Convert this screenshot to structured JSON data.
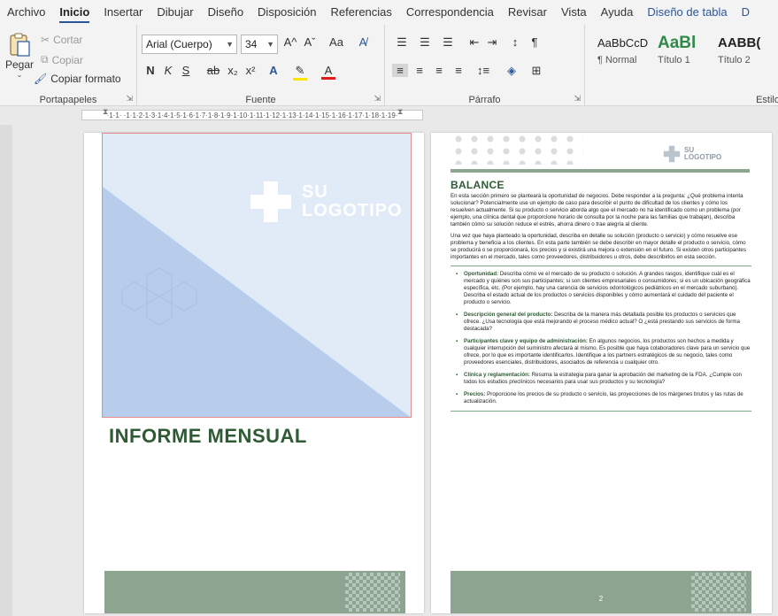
{
  "menu": {
    "items": [
      "Archivo",
      "Inicio",
      "Insertar",
      "Dibujar",
      "Diseño",
      "Disposición",
      "Referencias",
      "Correspondencia",
      "Revisar",
      "Vista",
      "Ayuda",
      "Diseño de tabla",
      "D"
    ],
    "active": "Inicio",
    "contextual": [
      "Diseño de tabla",
      "D"
    ]
  },
  "ribbon": {
    "clipboard": {
      "paste_label": "Pegar",
      "cut_label": "Cortar",
      "copy_label": "Copiar",
      "format_painter_label": "Copiar formato",
      "group_label": "Portapapeles"
    },
    "font": {
      "font_name": "Arial (Cuerpo)",
      "font_size": "34",
      "grow_label": "A^",
      "shrink_label": "Aˇ",
      "case_label": "Aa",
      "bold_label": "N",
      "italic_label": "K",
      "underline_label": "S",
      "strike_label": "ab",
      "subscript_label": "x₂",
      "superscript_label": "x²",
      "text_effects_label": "A",
      "highlight_label": "✎",
      "font_color_label": "A",
      "group_label": "Fuente"
    },
    "paragraph": {
      "group_label": "Párrafo"
    },
    "styles": {
      "items": [
        {
          "sample": "AaBbCcD",
          "name": "¶ Normal"
        },
        {
          "sample": "AaBl",
          "name": "Título 1"
        },
        {
          "sample": "AABB(",
          "name": "Título 2"
        }
      ],
      "group_label": "Estilo"
    }
  },
  "ruler": {
    "ticks": "·1·1·  ·1·1·2·1·3·1·4·1·5·1·6·1·7·1·8·1·9·1·10·1·11·1·12·1·13·1·14·1·15·1·16·1·17·1·18·1·19·"
  },
  "page1": {
    "logo_line1": "SU",
    "logo_line2": "LOGOTIPO",
    "title": "INFORME MENSUAL"
  },
  "page2": {
    "logo_line1": "SU",
    "logo_line2": "LOGOTIPO",
    "heading": "BALANCE",
    "para1": "En esta sección primero se planteará la oportunidad de negocios. Debe responder a la pregunta: ¿Qué problema intenta solucionar? Potencialmente use un ejemplo de caso para describir el punto de dificultad de los clientes y cómo los resuelven actualmente. Si su producto o servicio aborda algo que el mercado no ha identificado como un problema (por ejemplo, una clínica dental que proporcione horario de consulta por la noche para las familias que trabajan), describa también cómo su solución reduce el estrés, ahorra dinero o trae alegría al cliente.",
    "para2": "Una vez que haya planteado la oportunidad, describa en detalle su solución (producto o servicio) y cómo resuelve ese problema y beneficia a los clientes. En esta parte también se debe describir en mayor detalle el producto o servicio, cómo se producirá o se proporcionará, los precios y si existirá una mejora o extensión en el futuro. Si existen otros participantes importantes en el mercado, tales como proveedores, distribuidores u otros, debe describirlos en esta sección.",
    "bullets": [
      {
        "label": "Oportunidad:",
        "text": " Describa cómo ve el mercado de su producto o solución. A grandes rasgos, identifique cuál es el mercado y quiénes son sus participantes; si son clientes empresariales o consumidores; si es un ubicación geográfica específica, etc. (Por ejemplo, hay una carencia de servicios odontológicos pediátricos en el mercado suburbano). Describa el estado actual de los productos o servicios disponibles y cómo aumentará el cuidado del paciente el producto o servicio."
      },
      {
        "label": "Descripción general del producto:",
        "text": " Describa de la manera más detallada posible los productos o servicios que ofrece. ¿Usa tecnología que está mejorando el proceso médico actual? O ¿está prestando sus servicios de forma destacada?"
      },
      {
        "label": "Participantes clave y equipo de administración:",
        "text": " En algunos negocios, los productos son hechos a medida y cualquier interrupción del suministro afectará al mismo. Es posible que haya colaboradores clave para un servicio que ofrece, por lo que es importante identificarlos. Identifique a los partners estratégicos de su negocio, tales como proveedores esenciales, distribuidores, asociados de referencia u cualquier otro."
      },
      {
        "label": "Clínica y reglamentación:",
        "text": " Resuma la estrategia para ganar la aprobación del marketing de la FDA. ¿Cumple con todos los estudios preclínicos necesarios para usar sus productos y su tecnología?"
      },
      {
        "label": "Precios:",
        "text": " Proporcione los precios de su producto o servicio, las proyecciones de los márgenes brutos y las rutas de actualización."
      }
    ],
    "page_number": "2"
  },
  "colors": {
    "accent": "#2b579a",
    "heading_green": "#2e5b34",
    "band_green": "#8da491",
    "cover_blue": "#e1ebf8",
    "triangle_blue": "#b7cdeb"
  }
}
